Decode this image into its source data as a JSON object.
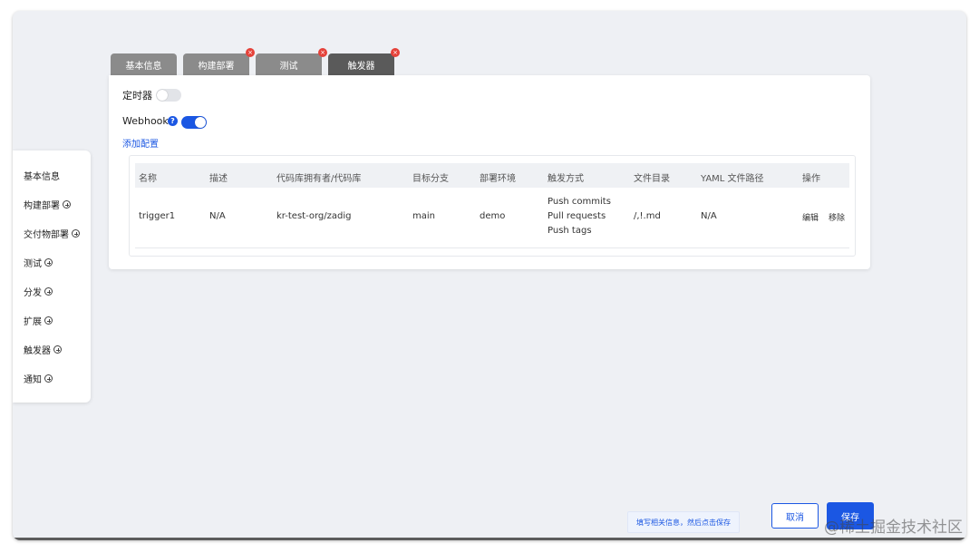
{
  "sidebar": {
    "items": [
      {
        "label": "基本信息",
        "has_add": false
      },
      {
        "label": "构建部署",
        "has_add": true
      },
      {
        "label": "交付物部署",
        "has_add": true
      },
      {
        "label": "测试",
        "has_add": true
      },
      {
        "label": "分发",
        "has_add": true
      },
      {
        "label": "扩展",
        "has_add": true
      },
      {
        "label": "触发器",
        "has_add": true
      },
      {
        "label": "通知",
        "has_add": true
      }
    ]
  },
  "tabs": [
    {
      "label": "基本信息",
      "closable": false,
      "active": false
    },
    {
      "label": "构建部署",
      "closable": true,
      "active": false
    },
    {
      "label": "测试",
      "closable": true,
      "active": false
    },
    {
      "label": "触发器",
      "closable": true,
      "active": true
    }
  ],
  "tab_close_glyph": "×",
  "timer": {
    "label": "定时器",
    "enabled": false
  },
  "webhook": {
    "label": "Webhook",
    "help_glyph": "?",
    "enabled": true,
    "add_config": "添加配置"
  },
  "table": {
    "headers": [
      "名称",
      "描述",
      "代码库拥有者/代码库",
      "目标分支",
      "部署环境",
      "触发方式",
      "文件目录",
      "YAML 文件路径",
      "操作"
    ],
    "rows": [
      {
        "name": "trigger1",
        "description": "N/A",
        "repo": "kr-test-org/zadig",
        "branch": "main",
        "env": "demo",
        "trigger_events": [
          "Push commits",
          "Pull requests",
          "Push tags"
        ],
        "file_dir": "/,!.md",
        "yaml_path": "N/A",
        "actions": {
          "edit": "编辑",
          "remove": "移除"
        }
      }
    ]
  },
  "footer": {
    "hint": "填写相关信息，然后点击保存",
    "cancel": "取消",
    "save": "保存"
  },
  "watermark": "@稀土掘金技术社区",
  "colors": {
    "accent": "#1b57e3",
    "danger": "#e5423a",
    "tab_active": "#5a5a5a",
    "tab": "#8b8b8b"
  }
}
